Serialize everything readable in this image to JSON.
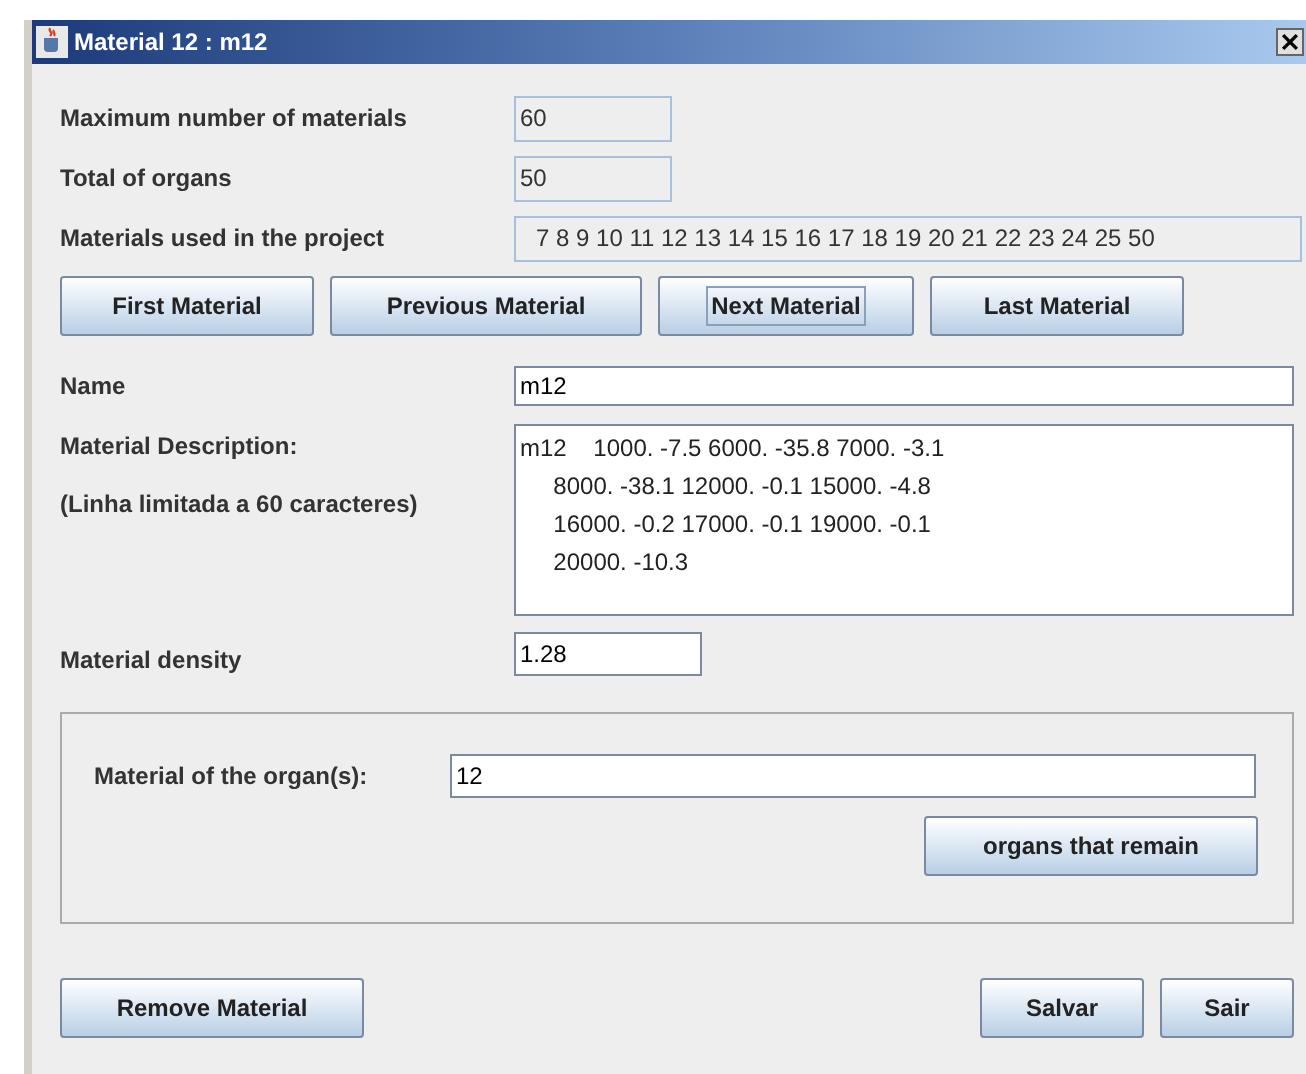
{
  "window": {
    "title": "Material 12 : m12"
  },
  "info_rows": [
    {
      "label": "Maximum number of materials",
      "value": "60",
      "wide": false
    },
    {
      "label": "Total of organs",
      "value": "50",
      "wide": false
    },
    {
      "label": "Materials used in the project",
      "value": "7 8 9 10 11 12 13 14 15 16 17 18 19 20 21 22 23 24 25 50",
      "wide": true
    }
  ],
  "nav_buttons": [
    {
      "label": "First Material",
      "focused": false
    },
    {
      "label": "Previous Material",
      "focused": false
    },
    {
      "label": "Next Material",
      "focused": true
    },
    {
      "label": "Last Material",
      "focused": false
    }
  ],
  "name": {
    "label": "Name",
    "value": "m12"
  },
  "description": {
    "label": "Material Description:",
    "note": "(Linha limitada a 60 caracteres)",
    "lines": [
      "m12    1000. -7.5 6000. -35.8 7000. -3.1",
      "     8000. -38.1 12000. -0.1 15000. -4.8",
      "     16000. -0.2 17000. -0.1 19000. -0.1",
      "     20000. -10.3"
    ]
  },
  "density": {
    "label": "Material density",
    "value": "1.28"
  },
  "organ_group": {
    "label": "Material of the organ(s):",
    "value": "12",
    "button": "organs that remain"
  },
  "bottom_buttons": {
    "remove": "Remove Material",
    "save": "Salvar",
    "exit": "Sair"
  }
}
